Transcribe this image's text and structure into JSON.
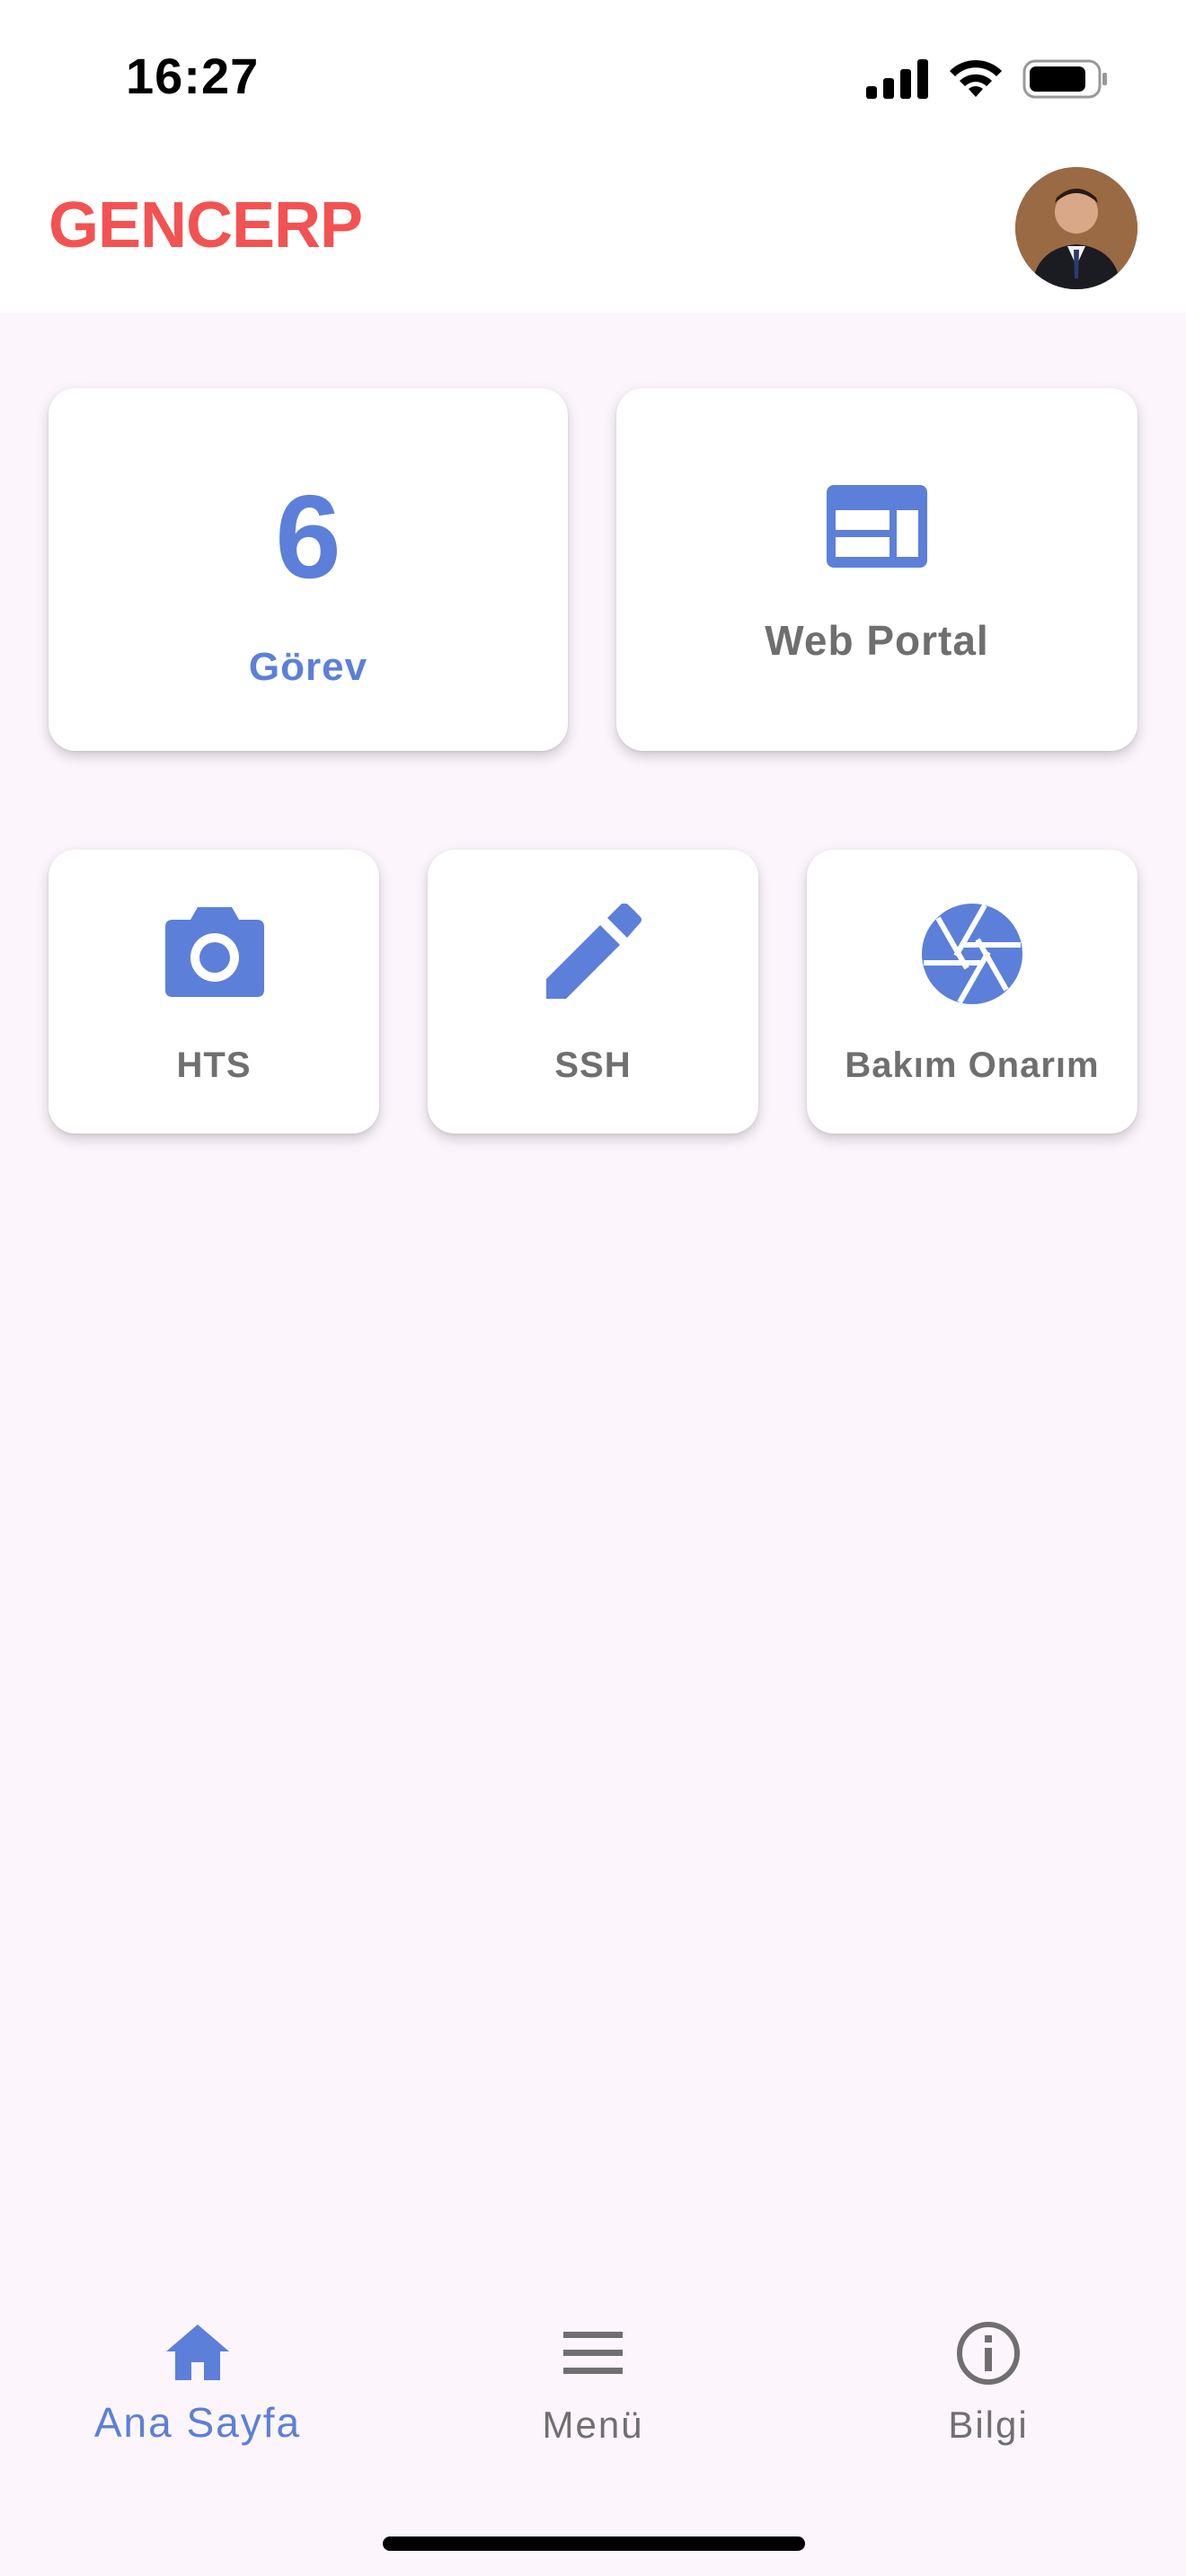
{
  "status_bar": {
    "time": "16:27"
  },
  "header": {
    "title": "GENCERP"
  },
  "cards": {
    "gorev": {
      "count": "6",
      "label": "Görev"
    },
    "web_portal": {
      "label": "Web Portal",
      "icon": "web-icon"
    },
    "hts": {
      "label": "HTS",
      "icon": "camera-icon"
    },
    "ssh": {
      "label": "SSH",
      "icon": "pencil-icon"
    },
    "bakim": {
      "label": "Bakım Onarım",
      "icon": "shutter-icon"
    }
  },
  "bottom_nav": {
    "items": [
      {
        "label": "Ana Sayfa",
        "icon": "home-icon",
        "active": true
      },
      {
        "label": "Menü",
        "icon": "menu-icon",
        "active": false
      },
      {
        "label": "Bilgi",
        "icon": "info-icon",
        "active": false
      }
    ]
  },
  "colors": {
    "accent": "#5c7fd9",
    "brand": "#f25352",
    "background": "#fcf5fc",
    "muted": "#6f6f6f"
  }
}
